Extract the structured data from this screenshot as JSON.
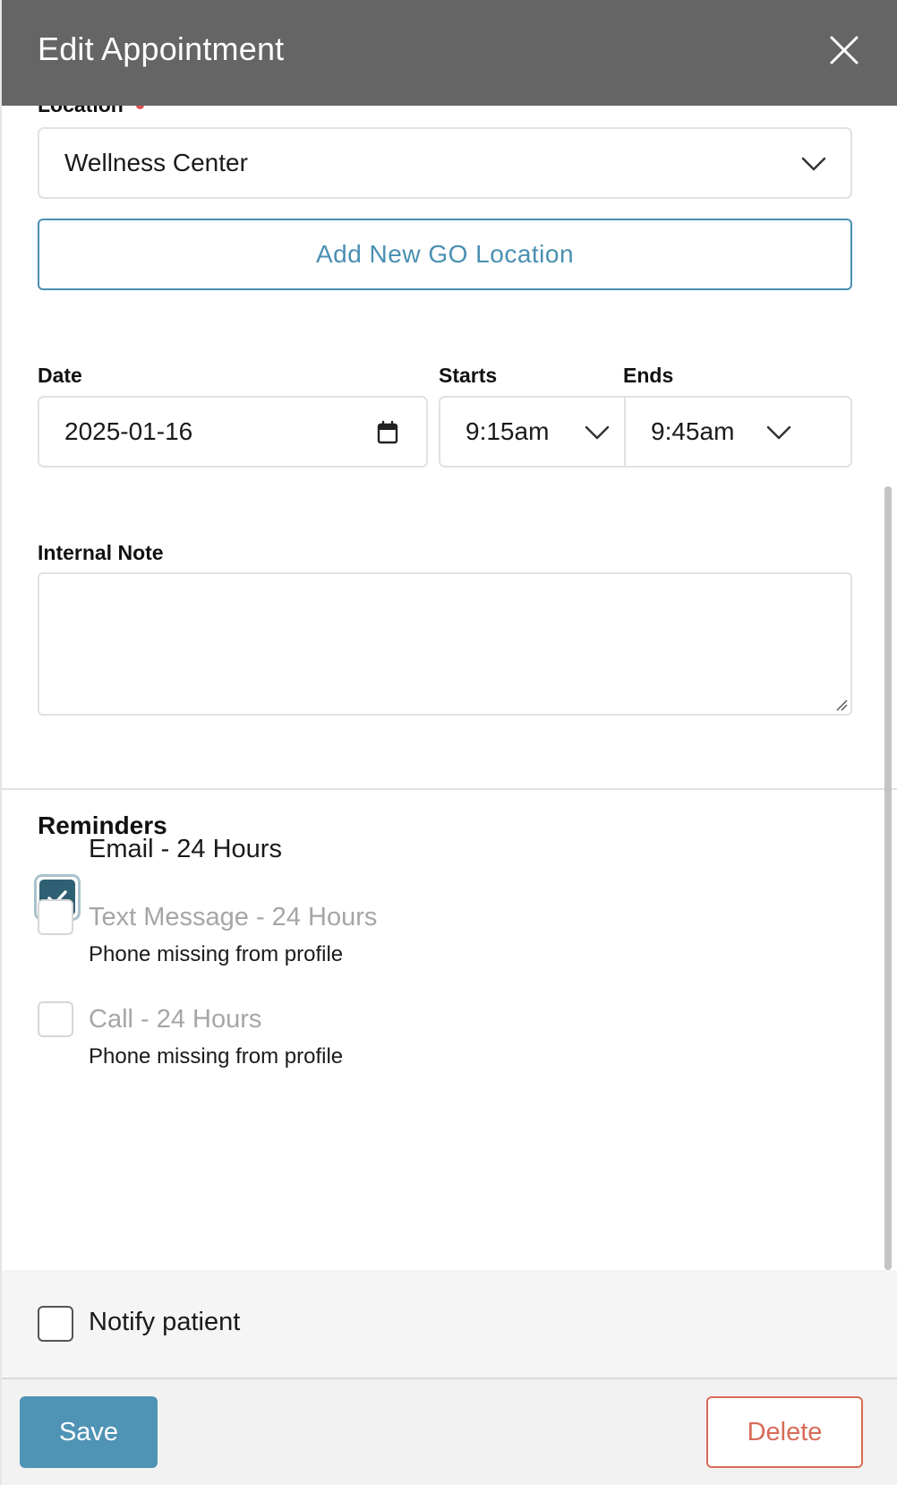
{
  "header": {
    "title": "Edit Appointment",
    "close_icon": "close-icon"
  },
  "location": {
    "label": "Location",
    "selected": "Wellness Center",
    "add_button": "Add New GO Location"
  },
  "schedule": {
    "date_label": "Date",
    "date_value": "2025-01-16",
    "starts_label": "Starts",
    "starts_value": "9:15am",
    "ends_label": "Ends",
    "ends_value": "9:45am"
  },
  "note": {
    "label": "Internal Note",
    "value": ""
  },
  "reminders": {
    "title": "Reminders",
    "items": [
      {
        "label": "Email - 24 Hours",
        "checked": true,
        "enabled": true,
        "sub": ""
      },
      {
        "label": "Text Message - 24 Hours",
        "checked": false,
        "enabled": false,
        "sub": "Phone missing from profile"
      },
      {
        "label": "Call - 24 Hours",
        "checked": false,
        "enabled": false,
        "sub": "Phone missing from profile"
      }
    ]
  },
  "notify": {
    "label": "Notify patient",
    "checked": false
  },
  "footer": {
    "save_label": "Save",
    "delete_label": "Delete"
  },
  "colors": {
    "header_bg": "#656565",
    "accent": "#4f93b5",
    "checkbox_checked": "#2f5f72",
    "danger": "#d86b57",
    "required": "#e05252"
  }
}
